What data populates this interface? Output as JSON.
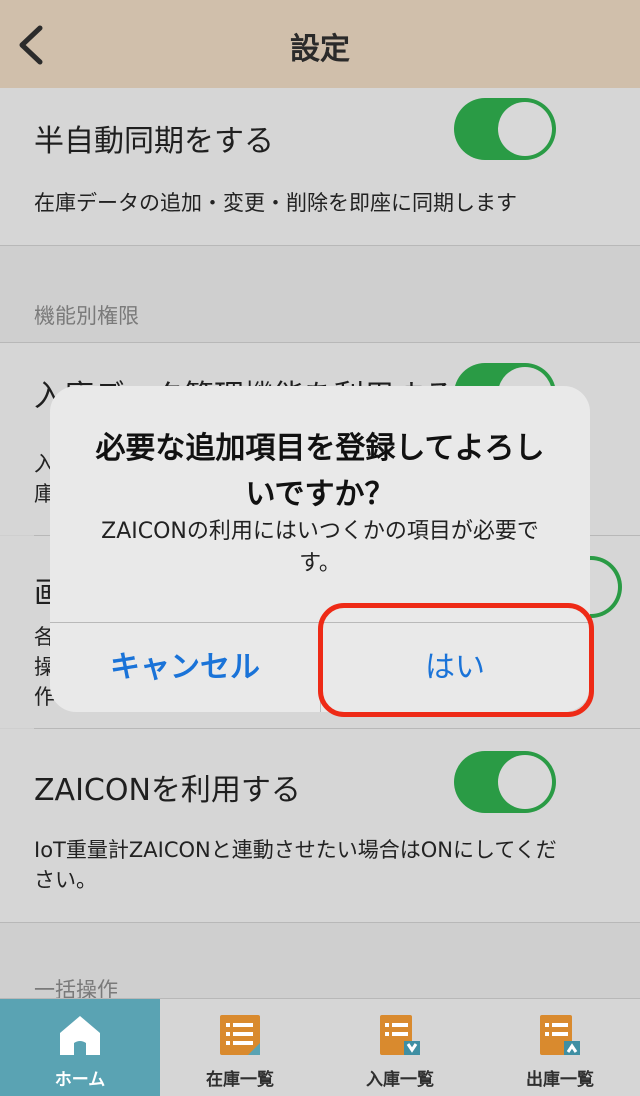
{
  "nav": {
    "title": "設定"
  },
  "settings": {
    "semi_auto_sync": {
      "title": "半自動同期をする",
      "description": "在庫データの追加・変更・削除を即座に同期します"
    },
    "section_permissions": "機能別権限",
    "stock_in_feature": {
      "title": "入庫データ管理機能を利用する",
      "description": "入\n庫"
    },
    "image_feature": {
      "title": "画",
      "description": "各\n操\n作"
    },
    "zaicon": {
      "title": "ZAICONを利用する",
      "description": "IoT重量計ZAICONと連動させたい場合はONにしてください。"
    },
    "section_bulk": "一括操作"
  },
  "alert": {
    "title": "必要な追加項目を登録してよろしいですか？",
    "message": "ZAICONの利用にはいつくかの項目が必要です。",
    "cancel_label": "キャンセル",
    "ok_label": "はい"
  },
  "tabs": [
    {
      "label": "ホーム",
      "icon": "home-icon",
      "active": true
    },
    {
      "label": "在庫一覧",
      "icon": "stock-list-icon",
      "active": false
    },
    {
      "label": "入庫一覧",
      "icon": "stock-in-list-icon",
      "active": false
    },
    {
      "label": "出庫一覧",
      "icon": "stock-out-list-icon",
      "active": false
    }
  ],
  "colors": {
    "nav_bg": "#d0bfab",
    "toggle_on": "#2a9b45",
    "alert_button": "#1a73d8",
    "highlight": "#ee2a16",
    "tab_active": "#5aa3b3",
    "icon_orange": "#d98a2e"
  }
}
